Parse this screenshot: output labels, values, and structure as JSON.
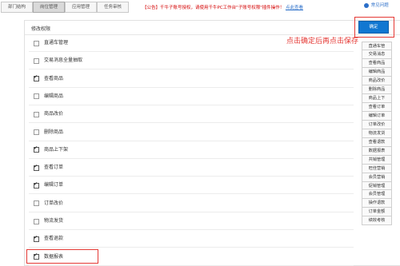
{
  "tabs": [
    {
      "label": "部门结构"
    },
    {
      "label": "岗位管理"
    },
    {
      "label": "应用管理"
    },
    {
      "label": "任务审核"
    }
  ],
  "announcement": {
    "prefix": "【公告】千牛子账号授权，请使用千牛PC工作台\"子账号权限\"插件操作！",
    "link": "点此查看"
  },
  "help_link": "常见问题",
  "panel": {
    "title": "修改权限",
    "confirm_label": "确定",
    "hint": "点击确定后再点击保存"
  },
  "permissions": [
    {
      "label": "直通车管理",
      "checked": false
    },
    {
      "label": "交易消息全量抽取",
      "checked": false
    },
    {
      "label": "查看商品",
      "checked": true
    },
    {
      "label": "编辑商品",
      "checked": false
    },
    {
      "label": "商品改价",
      "checked": false
    },
    {
      "label": "删除商品",
      "checked": false
    },
    {
      "label": "商品上下架",
      "checked": true
    },
    {
      "label": "查看订单",
      "checked": true
    },
    {
      "label": "编辑订单",
      "checked": true
    },
    {
      "label": "订单改价",
      "checked": false
    },
    {
      "label": "物流发货",
      "checked": false
    },
    {
      "label": "查看退款",
      "checked": true
    },
    {
      "label": "数据报表",
      "checked": true
    }
  ],
  "side_list": [
    "直通车管",
    "交易消息",
    "查看商品",
    "编辑商品",
    "商品改价",
    "删除商品",
    "商品上下",
    "查看订单",
    "编辑订单",
    "订单改价",
    "物流发货",
    "查看退款",
    "数据报表",
    "共销管理",
    "旺佳营销",
    "会员营销",
    "促销管理",
    "会员管理",
    "操作退款",
    "订单金额",
    "绩效考核"
  ]
}
